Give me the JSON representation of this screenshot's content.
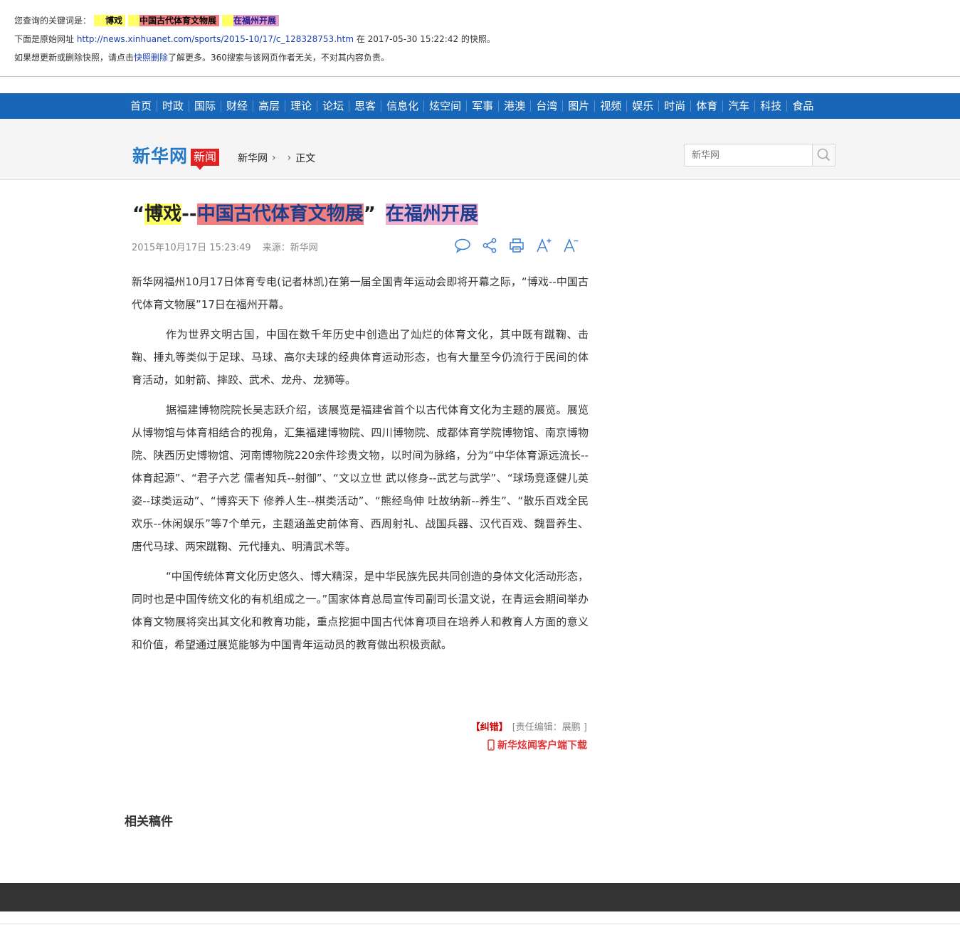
{
  "snapshot": {
    "kw_prefix": "您查询的关键词是：",
    "keywords": [
      "博戏",
      "中国古代体育文物展",
      "在福州开展"
    ],
    "line2_prefix": "下面是原始网址 ",
    "original_url": "http://news.xinhuanet.com/sports/2015-10/17/c_128328753.htm",
    "line2_mid": " 在 2017-05-30 15:22:42 的快照。",
    "line3_prefix": "如果想更新或删除快照，请点击",
    "delete_link": "快照删除",
    "line3_suffix": "了解更多。360搜索与该网页作者无关，不对其内容负责。"
  },
  "nav": {
    "items": [
      "首页",
      "时政",
      "国际",
      "财经",
      "高层",
      "理论",
      "论坛",
      "思客",
      "信息化",
      "炫空间",
      "军事",
      "港澳",
      "台湾",
      "图片",
      "视频",
      "娱乐",
      "时尚",
      "体育",
      "汽车",
      "科技",
      "食品"
    ]
  },
  "header": {
    "logo": "新华网",
    "badge": "新闻",
    "crumb_home": "新华网",
    "crumb_current": "正文",
    "search_placeholder": "新华网"
  },
  "article": {
    "title_q1": "“",
    "title_k1": "博戏",
    "title_dash": "--",
    "title_k2": "中国古代体育文物展",
    "title_q2": "”",
    "title_k3": "在福州开展",
    "date": "2015年10月17日 15:23:49",
    "source": "来源：新华网",
    "paragraphs": [
      "新华网福州10月17日体育专电(记者林凯)在第一届全国青年运动会即将开幕之际，“博戏--中国古代体育文物展”17日在福州开幕。",
      "作为世界文明古国，中国在数千年历史中创造出了灿烂的体育文化，其中既有蹴鞠、击鞠、捶丸等类似于足球、马球、高尔夫球的经典体育运动形态，也有大量至今仍流行于民间的体育活动，如射箭、摔跤、武术、龙舟、龙狮等。",
      "据福建博物院院长吴志跃介绍，该展览是福建省首个以古代体育文化为主题的展览。展览从博物馆与体育相结合的视角，汇集福建博物院、四川博物院、成都体育学院博物馆、南京博物院、陕西历史博物馆、河南博物院220余件珍贵文物，以时间为脉络，分为“中华体育源远流长--体育起源”、“君子六艺 儒者知兵--射御”、“文以立世 武以修身--武艺与武学”、“球场竞逐健儿英姿--球类运动”、“博弈天下 修养人生--棋类活动”、“熊经鸟伸 吐故纳新--养生”、“散乐百戏全民欢乐--休闲娱乐”等7个单元，主题涵盖史前体育、西周射礼、战国兵器、汉代百戏、魏晋养生、唐代马球、两宋蹴鞠、元代捶丸、明清武术等。",
      "“中国传统体育文化历史悠久、博大精深，是中华民族先民共同创造的身体文化活动形态，同时也是中国传统文化的有机组成之一。”国家体育总局宣传司副司长温文说，在青运会期间举办体育文物展将突出其文化和教育功能，重点挖掘中国古代体育项目在培养人和教育人方面的意义和价值，希望通过展览能够为中国青年运动员的教育做出积极贡献。"
    ],
    "fix_label": "【纠错】",
    "editor": "[责任编辑：展鹏 ]",
    "app_download": "新华炫闻客户端下载",
    "related": "相关稿件"
  }
}
